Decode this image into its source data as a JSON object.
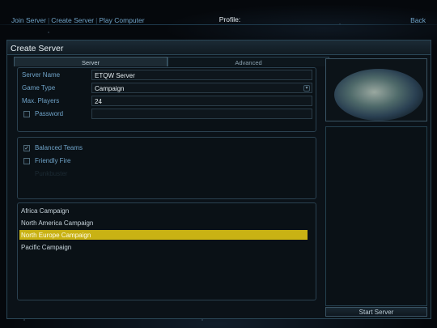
{
  "topnav": {
    "items": [
      "Join Server",
      "Create Server",
      "Play Computer"
    ],
    "separator": "|",
    "profile_label": "Profile:",
    "back_label": "Back"
  },
  "window": {
    "title": "Create Server",
    "tabs": [
      {
        "label": "Server",
        "active": true
      },
      {
        "label": "Advanced",
        "active": false
      }
    ]
  },
  "settings": {
    "server_name": {
      "label": "Server Name",
      "value": "ETQW Server"
    },
    "game_type": {
      "label": "Game Type",
      "value": "Campaign"
    },
    "max_players": {
      "label": "Max. Players",
      "value": "24"
    },
    "password": {
      "label": "Password",
      "value": "",
      "checked": false
    }
  },
  "options": [
    {
      "label": "Balanced Teams",
      "checked": true,
      "disabled": false
    },
    {
      "label": "Friendly Fire",
      "checked": false,
      "disabled": false
    },
    {
      "label": "Punkbuster",
      "checked": false,
      "disabled": true
    }
  ],
  "maps": {
    "items": [
      "Africa Campaign",
      "North America Campaign",
      "North Europe Campaign",
      "Pacific Campaign"
    ],
    "selected_index": 2
  },
  "start_button": {
    "label": "Start Server"
  },
  "colors": {
    "accent": "#6fa3c8",
    "selection": "#c9b214"
  }
}
